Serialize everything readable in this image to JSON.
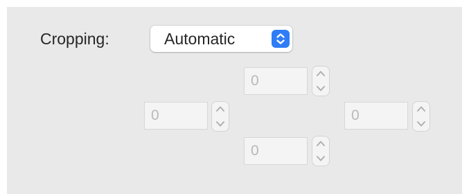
{
  "cropping": {
    "label": "Cropping:",
    "mode_value": "Automatic"
  },
  "fields": {
    "top": {
      "value": "0"
    },
    "left": {
      "value": "0"
    },
    "right": {
      "value": "0"
    },
    "bottom": {
      "value": "0"
    }
  },
  "icons": {
    "popup": "chevron-up-down-icon",
    "stepper_up": "chevron-up-icon",
    "stepper_down": "chevron-down-icon"
  },
  "colors": {
    "accent": "#2f7df6",
    "panel_bg": "#e9e9e9",
    "disabled_text": "#b9b9b9"
  }
}
